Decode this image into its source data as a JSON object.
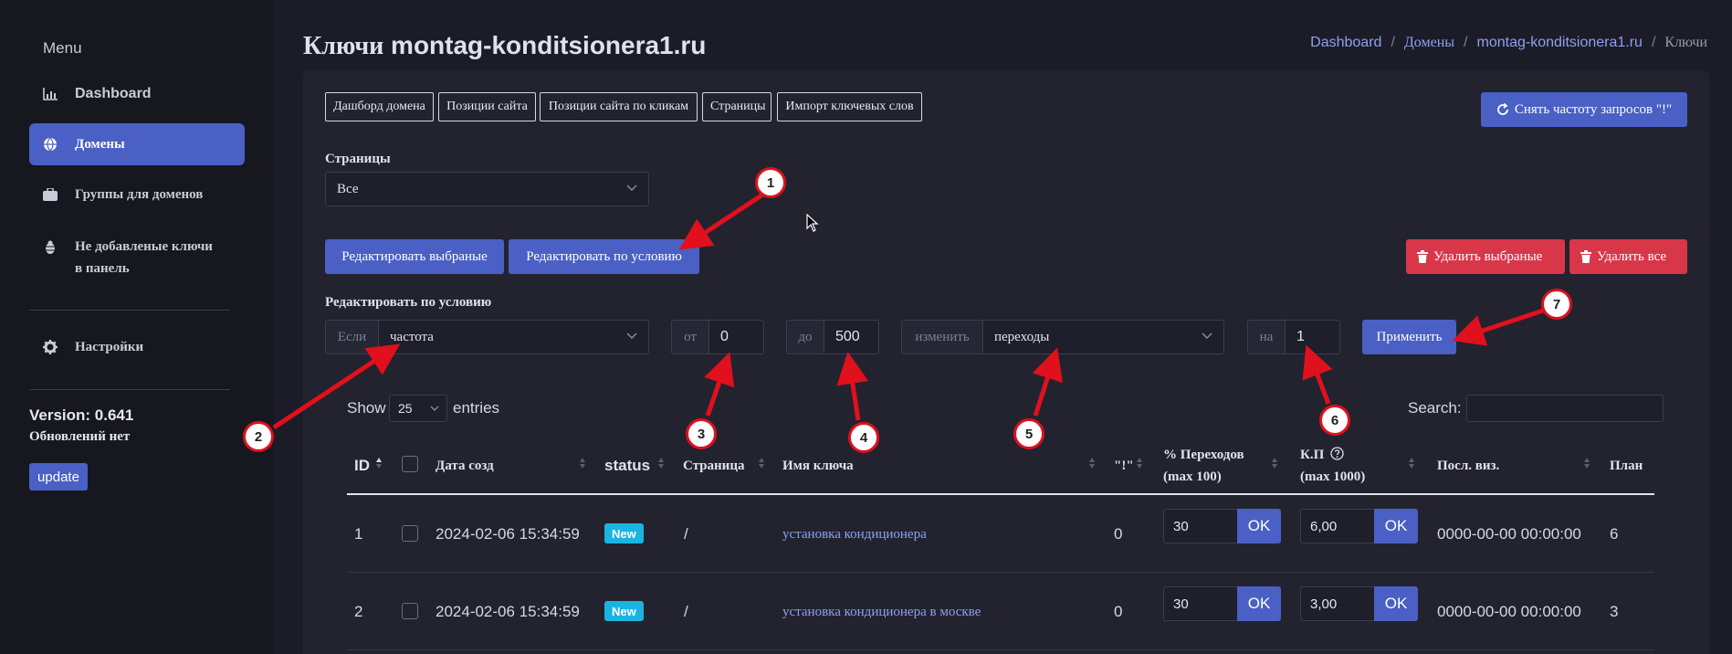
{
  "sidebar": {
    "menu_label": "Menu",
    "items": [
      {
        "label": "Dashboard",
        "icon": "chart-icon"
      },
      {
        "label": "Домены",
        "icon": "globe-icon"
      },
      {
        "label": "Группы для доменов",
        "icon": "briefcase-icon"
      },
      {
        "label_line1": "Не добавленые ключи",
        "label_line2": "в панель",
        "icon": "bug-icon"
      },
      {
        "label": "Настройки",
        "icon": "gear-icon"
      }
    ],
    "version": "Version: 0.641",
    "updates_status": "Обновлений нет",
    "update_button": "update"
  },
  "header": {
    "title_prefix": "Ключи",
    "title_domain": "montag-konditsionera1.ru",
    "breadcrumb": [
      "Dashboard",
      "Домены",
      "montag-konditsionera1.ru",
      "Ключи"
    ]
  },
  "tabs": [
    "Дашборд домена",
    "Позиции сайта",
    "Позиции сайта по кликам",
    "Страницы",
    "Импорт ключевых слов"
  ],
  "rate_button": "Снять частоту запросов \"!\"",
  "pages_filter": {
    "label": "Страницы",
    "value": "Все"
  },
  "actions": {
    "edit_selected": "Редактировать выбраные",
    "edit_by_condition": "Редактировать по условию",
    "delete_selected": "Удалить выбраные",
    "delete_all": "Удалить все"
  },
  "condition": {
    "label": "Редактировать по условию",
    "if_label": "Если",
    "if_value": "частота",
    "from_label": "от",
    "from_value": "0",
    "to_label": "до",
    "to_value": "500",
    "change_label": "изменить",
    "change_value": "переходы",
    "on_label": "на",
    "on_value": "1",
    "apply": "Применить"
  },
  "datatable": {
    "show": "Show",
    "length": "25",
    "entries": "entries",
    "search_label": "Search:",
    "columns": [
      "ID",
      "Дата созд",
      "status",
      "Страница",
      "Имя ключа",
      "\"!\"",
      "% Переходов",
      "(max 100)",
      "К.П",
      "(max 1000)",
      "Посл. виз.",
      "План"
    ],
    "ok_label": "OK",
    "rows": [
      {
        "id": "1",
        "date": "2024-02-06 15:34:59",
        "status": "New",
        "page": "/",
        "key": "установка кондиционера",
        "excl": "0",
        "transitions": "30",
        "kp": "6,00",
        "last_visit": "0000-00-00 00:00:00",
        "plan": "6"
      },
      {
        "id": "2",
        "date": "2024-02-06 15:34:59",
        "status": "New",
        "page": "/",
        "key": "установка кондиционера в москве",
        "excl": "0",
        "transitions": "30",
        "kp": "3,00",
        "last_visit": "0000-00-00 00:00:00",
        "plan": "3"
      }
    ]
  },
  "annotations": [
    "1",
    "2",
    "3",
    "4",
    "5",
    "6",
    "7"
  ],
  "colors": {
    "accent": "#4a60c4",
    "danger": "#d8374a",
    "badge": "#1ab4e3",
    "marker": "#e0101c",
    "background": "#1b1c28"
  }
}
